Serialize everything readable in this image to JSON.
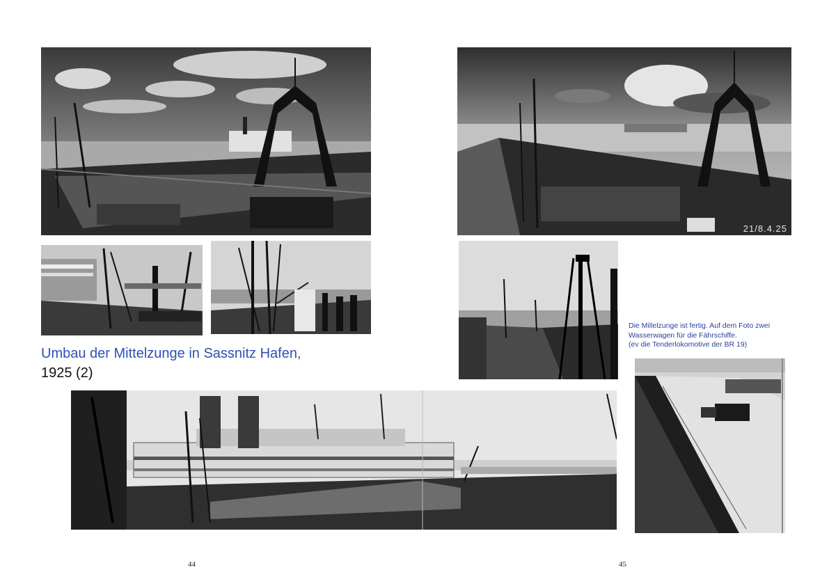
{
  "left_page": {
    "title_line1": "Umbau der Mittelzunge in Sassnitz Hafen,",
    "title_line2": "1925 (2)",
    "page_number": "44"
  },
  "right_page": {
    "caption_lines": [
      "Die Millelzunge ist fertig. Auf dem Foto zwei",
      "Wasserwagen für die Fährschiffe.",
      "(ev die Tenderlokomotive der BR 19)"
    ],
    "page_number": "45"
  },
  "photo_stamps": {
    "top_right": "21/8.4.25"
  },
  "colors": {
    "title_blue": "#2f4fb5",
    "caption_blue": "#2a3f9c"
  }
}
